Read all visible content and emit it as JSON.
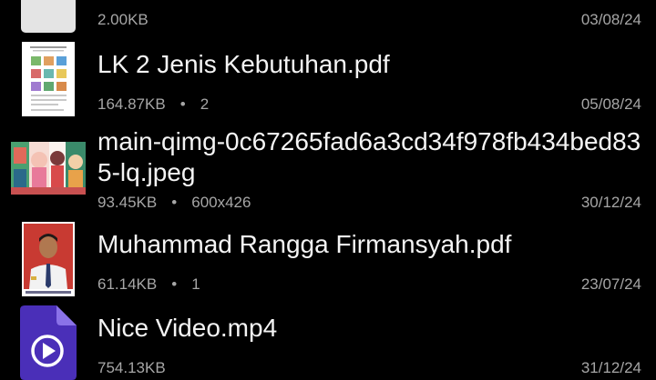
{
  "files": [
    {
      "name": "",
      "size": "2.00KB",
      "extra": "",
      "date": "03/08/24",
      "thumbnail": "blank-file-icon"
    },
    {
      "name": "LK 2 Jenis Kebutuhan.pdf",
      "size": "164.87KB",
      "extra": "2",
      "date": "05/08/24",
      "thumbnail": "pdf-page-thumbnail"
    },
    {
      "name": "main-qimg-0c67265fad6a3cd34f978fb434bed835-lq.jpeg",
      "size": "93.45KB",
      "extra": "600x426",
      "date": "30/12/24",
      "thumbnail": "anime-image-thumbnail"
    },
    {
      "name": "Muhammad Rangga Firmansyah.pdf",
      "size": "61.14KB",
      "extra": "1",
      "date": "23/07/24",
      "thumbnail": "portrait-photo-thumbnail"
    },
    {
      "name": "Nice Video.mp4",
      "size": "754.13KB",
      "extra": "",
      "date": "31/12/24",
      "thumbnail": "video-file-icon"
    }
  ],
  "colors": {
    "background": "#000000",
    "primary_text": "#f4f4f4",
    "secondary_text": "#a6a6a6",
    "video_icon": "#4a2fb8"
  }
}
